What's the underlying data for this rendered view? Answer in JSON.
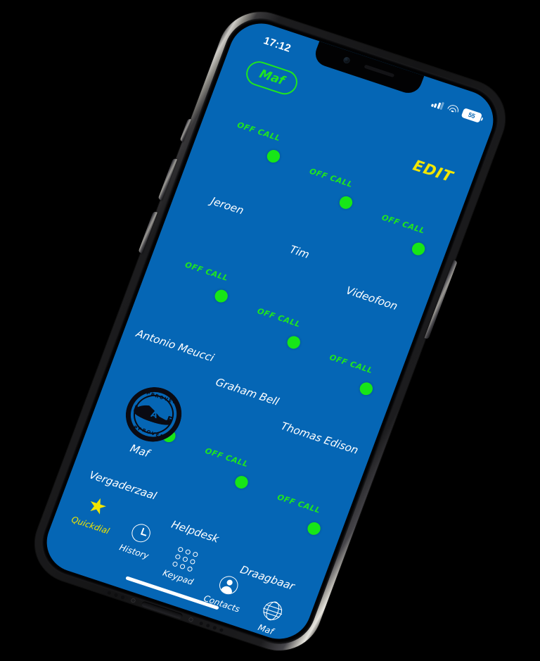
{
  "device": {
    "type": "smartphone",
    "orientation": "portrait-tilted",
    "frame_color": "#1c1c1e"
  },
  "theme": {
    "screen_background": "#0566b5",
    "accent_green": "#1fe61f",
    "accent_yellow": "#f2e600",
    "status_dot": "#17e617",
    "text_primary": "#ffffff"
  },
  "status_bar": {
    "time": "17:12",
    "signal_icon": "cellular-signal-icon",
    "wifi_icon": "wifi-icon",
    "battery_icon": "battery-icon",
    "battery_level": "55"
  },
  "header": {
    "account_pill": "Maf",
    "edit_label": "EDIT"
  },
  "contacts": [
    {
      "name": "Jeroen",
      "status": "OFF CALL",
      "avatar": "av-jeroen",
      "presence": "available"
    },
    {
      "name": "Tim",
      "status": "OFF CALL",
      "avatar": "av-tim",
      "presence": "available"
    },
    {
      "name": "Videofoon",
      "status": "OFF CALL",
      "avatar": "av-videofoon",
      "presence": "available"
    },
    {
      "name": "Antonio Meucci",
      "status": "OFF CALL",
      "avatar": "av-meucci",
      "presence": "available"
    },
    {
      "name": "Graham Bell",
      "status": "OFF CALL",
      "avatar": "av-bell",
      "presence": "available"
    },
    {
      "name": "Thomas Edison",
      "status": "OFF CALL",
      "avatar": "av-edison",
      "presence": "available"
    },
    {
      "name": "Vergaderzaal",
      "status": "OFF CALL",
      "avatar": "av-vergaderzaal",
      "presence": "available"
    },
    {
      "name": "Helpdesk",
      "status": "OFF CALL",
      "avatar": "av-helpdesk",
      "presence": "available"
    },
    {
      "name": "Draagbaar",
      "status": "OFF CALL",
      "avatar": "av-draagbaar",
      "presence": "available"
    }
  ],
  "logo_tile": {
    "label": "Maf",
    "logo_text_top": "APPROVED",
    "logo_text_bottom": "APPROVED",
    "logo_letters": [
      "M",
      "A",
      "F"
    ],
    "icon": "maf-approved-stamp-icon"
  },
  "tab_bar": {
    "active": "Quickdial",
    "items": [
      {
        "label": "Quickdial",
        "icon": "star-icon",
        "active": true
      },
      {
        "label": "History",
        "icon": "clock-icon",
        "active": false
      },
      {
        "label": "Keypad",
        "icon": "keypad-icon",
        "active": false
      },
      {
        "label": "Contacts",
        "icon": "person-icon",
        "active": false
      },
      {
        "label": "Maf",
        "icon": "globe-icon",
        "active": false
      }
    ]
  }
}
